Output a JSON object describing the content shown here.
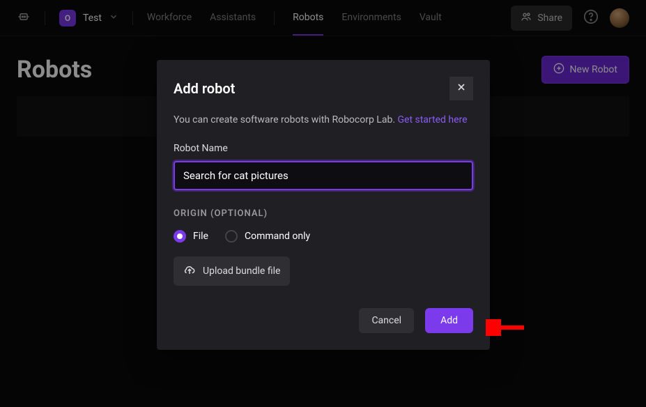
{
  "header": {
    "org_initial": "O",
    "org_name": "Test",
    "nav": {
      "workforce": "Workforce",
      "assistants": "Assistants",
      "robots": "Robots",
      "environments": "Environments",
      "vault": "Vault"
    },
    "share_label": "Share"
  },
  "page": {
    "title": "Robots",
    "new_label": "New Robot"
  },
  "modal": {
    "title": "Add robot",
    "intro_text": "You can create software robots with Robocorp Lab. ",
    "intro_link": "Get started here",
    "name_label": "Robot Name",
    "name_value": "Search for cat pictures",
    "origin_label": "ORIGIN (OPTIONAL)",
    "origin_options": {
      "file": "File",
      "command": "Command only"
    },
    "upload_label": "Upload bundle file",
    "cancel_label": "Cancel",
    "add_label": "Add"
  }
}
